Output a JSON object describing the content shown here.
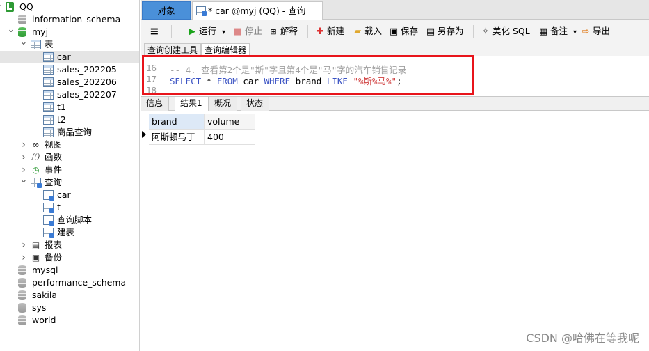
{
  "sidebar": {
    "items": [
      {
        "label": "QQ",
        "arrow": "v",
        "icon": "connection-icon"
      },
      {
        "label": "information_schema",
        "icon": "database-icon"
      },
      {
        "label": "myj",
        "arrow": "v",
        "icon": "database-icon"
      },
      {
        "label": "表",
        "arrow": "v",
        "icon": "tables-folder-icon"
      },
      {
        "label": "car",
        "icon": "table-icon"
      },
      {
        "label": "sales_202205",
        "icon": "table-icon"
      },
      {
        "label": "sales_202206",
        "icon": "table-icon"
      },
      {
        "label": "sales_202207",
        "icon": "table-icon"
      },
      {
        "label": "t1",
        "icon": "table-icon"
      },
      {
        "label": "t2",
        "icon": "table-icon"
      },
      {
        "label": "商品查询",
        "icon": "table-icon"
      },
      {
        "label": "视图",
        "arrow": ">",
        "icon": "view-icon"
      },
      {
        "label": "函数",
        "arrow": ">",
        "icon": "function-icon"
      },
      {
        "label": "事件",
        "arrow": ">",
        "icon": "event-icon"
      },
      {
        "label": "查询",
        "arrow": "v",
        "icon": "queries-folder-icon"
      },
      {
        "label": "car",
        "icon": "query-icon"
      },
      {
        "label": "t",
        "icon": "query-icon"
      },
      {
        "label": "查询脚本",
        "icon": "query-icon"
      },
      {
        "label": "建表",
        "icon": "query-icon"
      },
      {
        "label": "报表",
        "arrow": ">",
        "icon": "report-icon"
      },
      {
        "label": "备份",
        "arrow": ">",
        "icon": "backup-icon"
      },
      {
        "label": "mysql",
        "icon": "database-icon"
      },
      {
        "label": "performance_schema",
        "icon": "database-icon"
      },
      {
        "label": "sakila",
        "icon": "database-icon"
      },
      {
        "label": "sys",
        "icon": "database-icon"
      },
      {
        "label": "world",
        "icon": "database-icon"
      }
    ]
  },
  "tabs": {
    "objects": "对象",
    "query": "* car @myj (QQ) - 查询"
  },
  "toolbar": {
    "menu_icon": "≡",
    "run": "运行",
    "run_caret": "▾",
    "stop": "停止",
    "explain": "解释",
    "new": "新建",
    "load": "载入",
    "save": "保存",
    "save_as": "另存为",
    "beautify": "美化 SQL",
    "notes": "备注",
    "notes_caret": "▾",
    "export": "导出"
  },
  "subtabs": {
    "builder": "查询创建工具",
    "editor": "查询编辑器"
  },
  "editor": {
    "lines": [
      {
        "num": "16",
        "comment": "-- 4. 查看第2个是\"斯\"字且第4个是\"马\"字的汽车销售记录"
      },
      {
        "num": "17",
        "kw1": "SELECT",
        "t1": " * ",
        "kw2": "FROM",
        "t2": " car ",
        "kw3": "WHERE",
        "t3": " brand ",
        "kw4": "LIKE",
        "t4": " ",
        "str": "\"%斯%马%\"",
        "t5": ";"
      },
      {
        "num": "18"
      }
    ]
  },
  "result_tabs": [
    "信息",
    "结果1",
    "概况",
    "状态"
  ],
  "result": {
    "columns": [
      "brand",
      "volume"
    ],
    "rows": [
      [
        "阿斯顿马丁",
        "400"
      ]
    ]
  },
  "watermark": "CSDN @哈佛在等我呢",
  "colors": {
    "objects_tab": "#4a90d9",
    "highlight_box": "#e8141b",
    "keyword": "#3c54c4",
    "string": "#d04040"
  }
}
